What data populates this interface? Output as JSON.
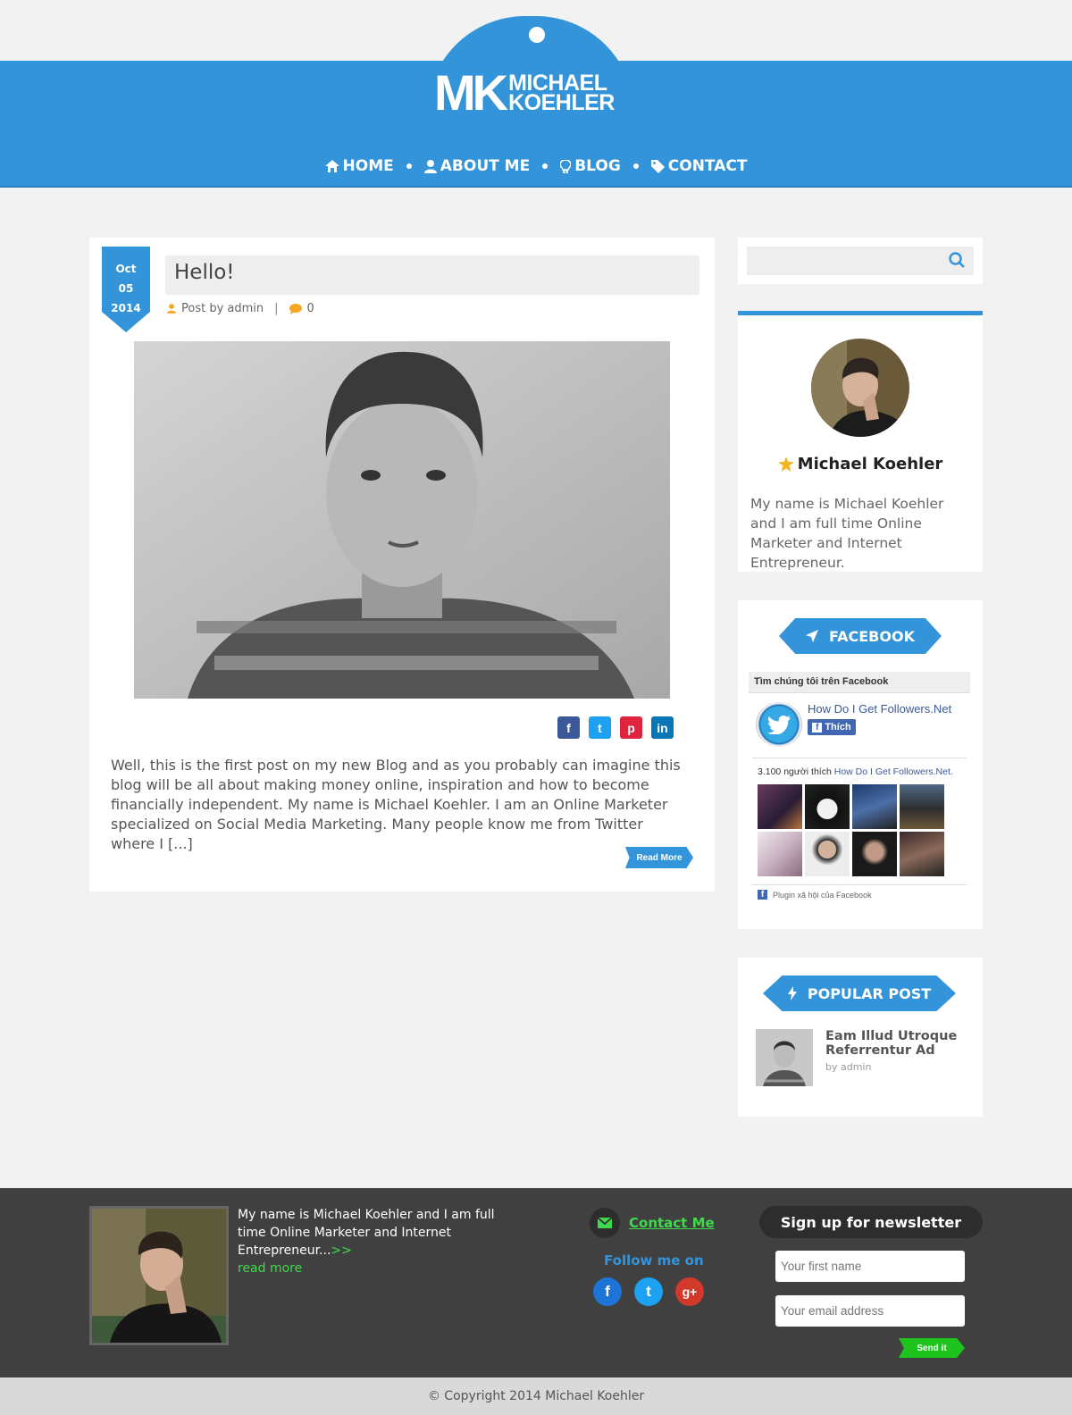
{
  "brand": {
    "monogram": "MK",
    "name_line1": "MICHAEL",
    "name_line2": "KOEHLER"
  },
  "nav": {
    "items": [
      {
        "label": "HOME",
        "icon": "home-icon"
      },
      {
        "label": "ABOUT ME",
        "icon": "user-icon"
      },
      {
        "label": "BLOG",
        "icon": "lightbulb-icon"
      },
      {
        "label": "CONTACT",
        "icon": "tag-icon"
      }
    ]
  },
  "post": {
    "date": {
      "month": "Oct",
      "day": "05",
      "year": "2014"
    },
    "title": "Hello!",
    "author": "Post by admin",
    "comments": "0",
    "excerpt": "Well, this is the first post on my new Blog and as you probably can imagine this blog will be all about making money online, inspiration and how to become financially independent. My name is Michael Koehler. I am an Online Marketer specialized on Social Media Marketing. Many people know me from Twitter where I [...]",
    "read_more": "Read More",
    "share": [
      "f",
      "t",
      "p",
      "in"
    ]
  },
  "sidebar": {
    "search": {
      "placeholder": ""
    },
    "about": {
      "name": "Michael Koehler",
      "desc": "My name is Michael Koehler and I am full time Online Marketer and Internet Entrepreneur."
    },
    "facebook": {
      "title": "FACEBOOK",
      "box_title": "Tìm chúng tôi trên Facebook",
      "page_name": "How Do I Get Followers.Net",
      "like_label": "Thích",
      "count_text": "3.100 người thích",
      "count_page": "How Do I Get Followers.Net.",
      "plugin_text": "Plugin xã hội của Facebook"
    },
    "popular": {
      "title": "POPULAR POST",
      "items": [
        {
          "title": "Eam Illud Utroque Referrentur Ad",
          "by": "by admin"
        }
      ]
    }
  },
  "footer": {
    "about_text": "My name is Michael Koehler and I am full time Online Marketer and Internet Entrepreneur...",
    "arrow": ">>",
    "read_more": "read more",
    "contact_label": "Contact Me",
    "follow_label": "Follow me on",
    "social": [
      "f",
      "t",
      "g+"
    ],
    "newsletter_title": "Sign up for newsletter",
    "first_name_placeholder": "Your first name",
    "email_placeholder": "Your email address",
    "send_label": "Send it",
    "copyright": "© Copyright 2014 Michael Koehler"
  },
  "colors": {
    "accent": "#3394d9",
    "footer_bg": "#404040",
    "green": "#3fd94c"
  }
}
